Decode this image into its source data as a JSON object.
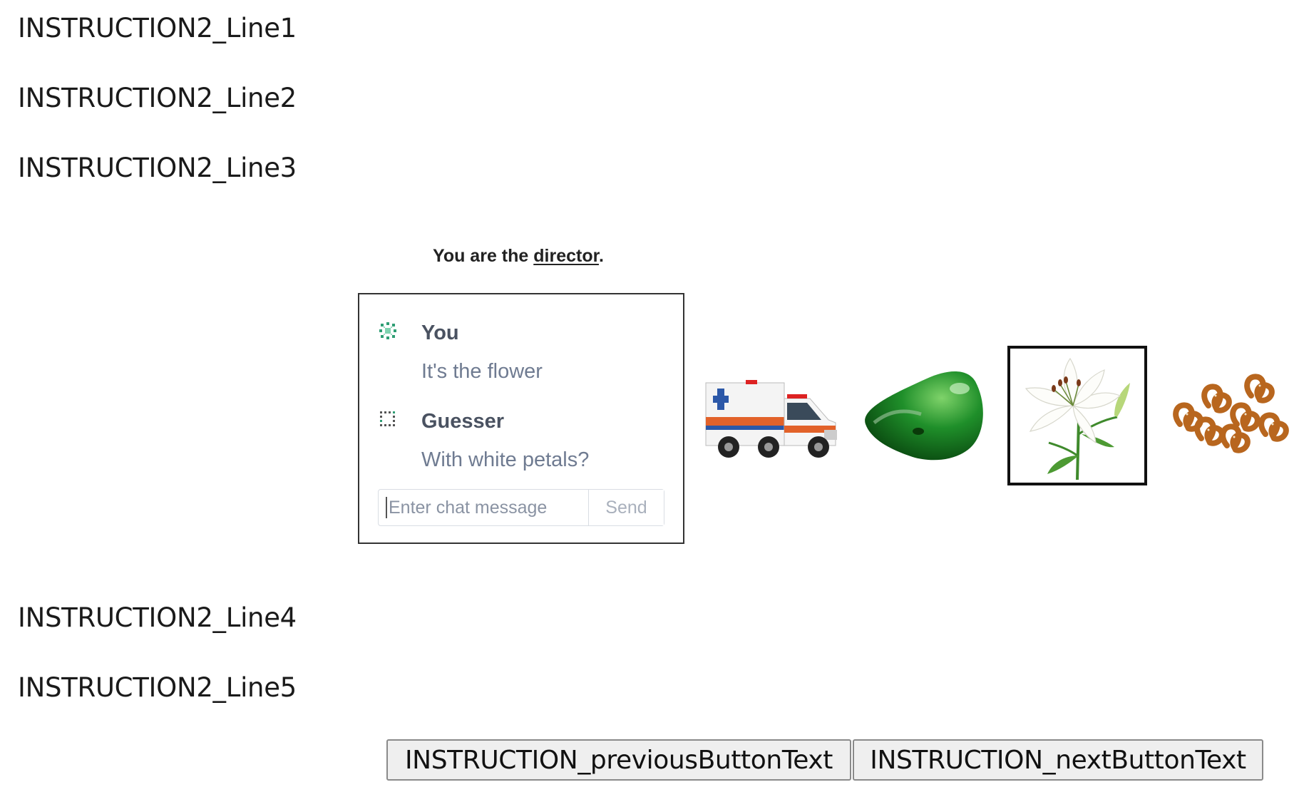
{
  "instructions": {
    "line1": "INSTRUCTION2_Line1",
    "line2": "INSTRUCTION2_Line2",
    "line3": "INSTRUCTION2_Line3",
    "line4": "INSTRUCTION2_Line4",
    "line5": "INSTRUCTION2_Line5"
  },
  "role_banner": {
    "prefix": "You are the ",
    "role": "director",
    "suffix": "."
  },
  "chat": {
    "messages": [
      {
        "sender": "You",
        "text": "It's the flower",
        "avatar_icon": "green-grid-avatar-icon"
      },
      {
        "sender": "Guesser",
        "text": "With white petals?",
        "avatar_icon": "dotted-square-avatar-icon"
      }
    ],
    "input_placeholder": "Enter chat message",
    "input_value": "",
    "send_label": "Send"
  },
  "images": [
    {
      "name": "ambulance",
      "selected": false
    },
    {
      "name": "green-computer-mouse",
      "selected": false
    },
    {
      "name": "white-lily-flower",
      "selected": true
    },
    {
      "name": "pretzels",
      "selected": false
    }
  ],
  "navigation": {
    "previous_label": "INSTRUCTION_previousButtonText",
    "next_label": "INSTRUCTION_nextButtonText"
  },
  "colors": {
    "sender_text": "#4a5261",
    "message_text": "#6f7b91",
    "target_border": "#111111",
    "button_bg": "#efefef"
  }
}
